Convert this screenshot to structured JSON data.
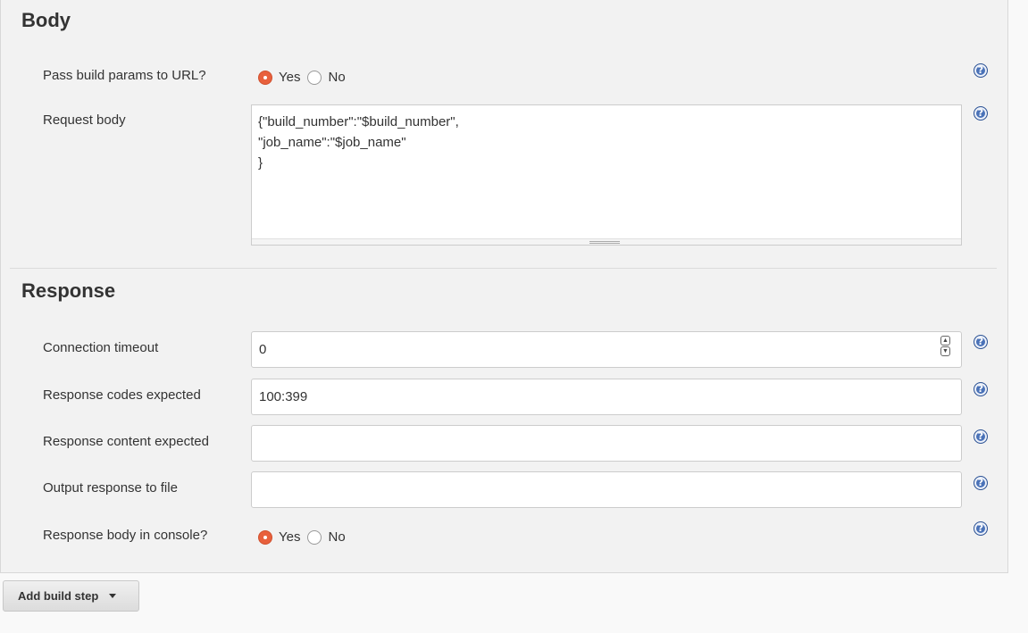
{
  "body_section": {
    "title": "Body",
    "pass_params": {
      "label": "Pass build params to URL?",
      "yes": "Yes",
      "no": "No",
      "selected": "Yes"
    },
    "request_body": {
      "label": "Request body",
      "value": "{\"build_number\":\"$build_number\",\n\"job_name\":\"$job_name\"\n}"
    }
  },
  "response_section": {
    "title": "Response",
    "connection_timeout": {
      "label": "Connection timeout",
      "value": "0"
    },
    "codes_expected": {
      "label": "Response codes expected",
      "value": "100:399"
    },
    "content_expected": {
      "label": "Response content expected",
      "value": ""
    },
    "output_file": {
      "label": "Output response to file",
      "value": ""
    },
    "body_in_console": {
      "label": "Response body in console?",
      "yes": "Yes",
      "no": "No",
      "selected": "Yes"
    }
  },
  "actions": {
    "add_build_step": "Add build step"
  },
  "icons": {
    "help": "help-icon",
    "spin_up": "chevron-up-icon",
    "spin_down": "chevron-down-icon",
    "dropdown": "caret-down-icon"
  },
  "colors": {
    "radio_checked": "#e8603c",
    "help_icon": "#4a72b8",
    "panel_bg": "#f2f2f2"
  }
}
